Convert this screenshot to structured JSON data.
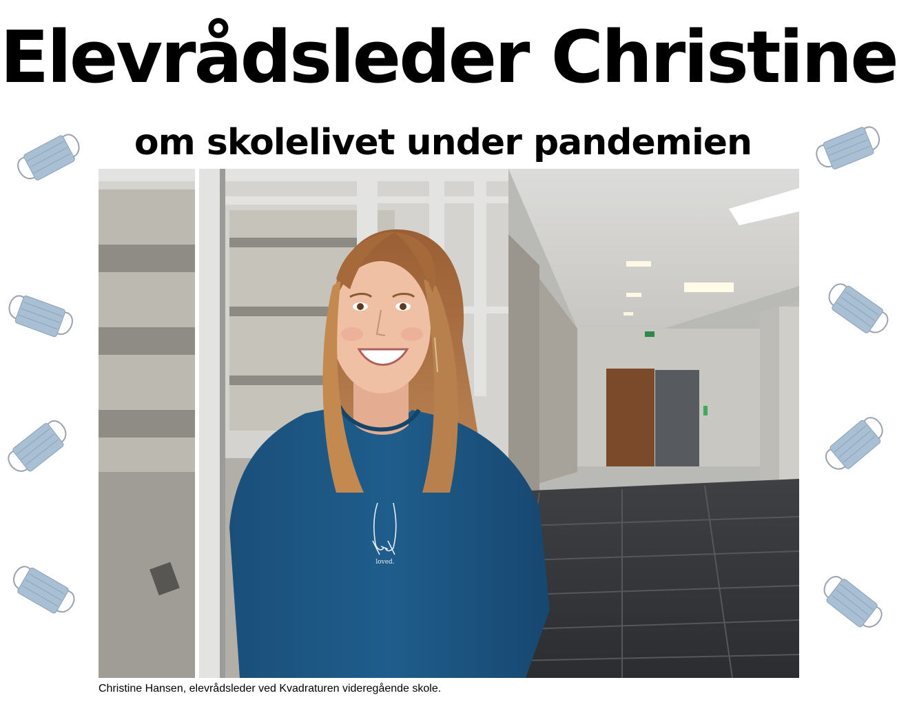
{
  "article": {
    "headline": "Elevrådsleder Christine",
    "subheadline": "om skolelivet under pandemien",
    "caption": "Christine Hansen, elevrådsleder ved Kvadraturen videregående skole.",
    "shirt_print": "loved."
  },
  "decorations": {
    "icon": "face-mask-icon",
    "mask_color": "#a9bfd3"
  }
}
